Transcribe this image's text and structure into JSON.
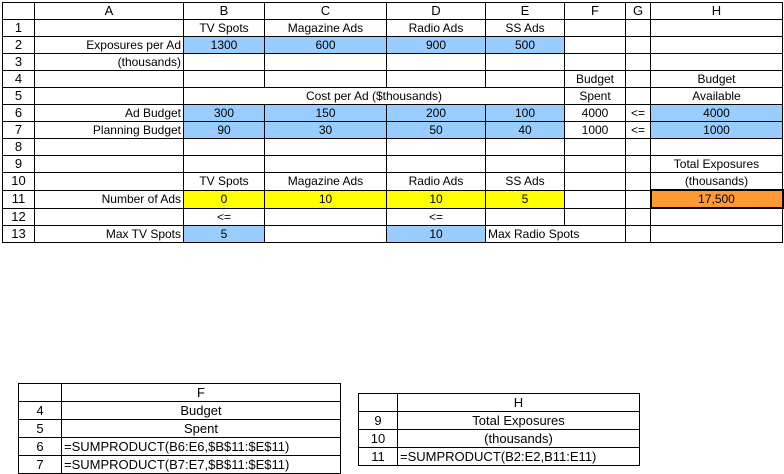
{
  "columns": [
    "A",
    "B",
    "C",
    "D",
    "E",
    "F",
    "G",
    "H"
  ],
  "rows": {
    "r1": {
      "num": "1",
      "B": "TV Spots",
      "C": "Magazine Ads",
      "D": "Radio Ads",
      "E": "SS Ads"
    },
    "r2": {
      "num": "2",
      "A": "Exposures per Ad",
      "B": "1300",
      "C": "600",
      "D": "900",
      "E": "500"
    },
    "r3": {
      "num": "3",
      "A": "(thousands)"
    },
    "r4": {
      "num": "4",
      "F": "Budget",
      "H": "Budget"
    },
    "r5": {
      "num": "5",
      "BCDE": "Cost per Ad ($thousands)",
      "F": "Spent",
      "H": "Available"
    },
    "r6": {
      "num": "6",
      "A": "Ad Budget",
      "B": "300",
      "C": "150",
      "D": "200",
      "E": "100",
      "F": "4000",
      "G": "<=",
      "H": "4000"
    },
    "r7": {
      "num": "7",
      "A": "Planning Budget",
      "B": "90",
      "C": "30",
      "D": "50",
      "E": "40",
      "F": "1000",
      "G": "<=",
      "H": "1000"
    },
    "r8": {
      "num": "8"
    },
    "r9": {
      "num": "9",
      "H": "Total Exposures"
    },
    "r10": {
      "num": "10",
      "B": "TV Spots",
      "C": "Magazine Ads",
      "D": "Radio Ads",
      "E": "SS Ads",
      "H": "(thousands)"
    },
    "r11": {
      "num": "11",
      "A": "Number of Ads",
      "B": "0",
      "C": "10",
      "D": "10",
      "E": "5",
      "H": "17,500"
    },
    "r12": {
      "num": "12",
      "B": "<=",
      "D": "<="
    },
    "r13": {
      "num": "13",
      "A": "Max TV Spots",
      "B": "5",
      "D": "10",
      "E": "Max Radio Spots"
    }
  },
  "formula_f": {
    "col": "F",
    "rows": [
      {
        "num": "4",
        "text": "Budget"
      },
      {
        "num": "5",
        "text": "Spent"
      },
      {
        "num": "6",
        "text": "=SUMPRODUCT(B6:E6,$B$11:$E$11)"
      },
      {
        "num": "7",
        "text": "=SUMPRODUCT(B7:E7,$B$11:$E$11)"
      }
    ]
  },
  "formula_h": {
    "col": "H",
    "rows": [
      {
        "num": "9",
        "text": "Total Exposures"
      },
      {
        "num": "10",
        "text": "(thousands)"
      },
      {
        "num": "11",
        "text": "=SUMPRODUCT(B2:E2,B11:E11)"
      }
    ]
  },
  "colors": {
    "input": "#99ccff",
    "changing": "#ffff00",
    "objective": "#ff9933"
  }
}
